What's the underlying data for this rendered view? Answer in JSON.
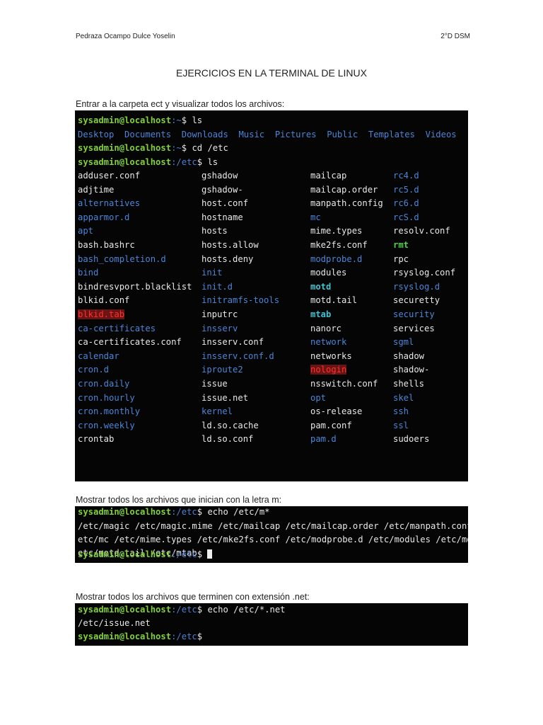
{
  "header": {
    "author": "Pedraza Ocampo Dulce Yoselin",
    "group": "2°D DSM"
  },
  "title": "EJERCICIOS EN LA TERMINAL DE LINUX",
  "sections": [
    {
      "caption": "Entrar a la carpeta ect y visualizar todos los archivos:"
    },
    {
      "caption": "Mostrar todos los archivos que inician con la letra m:"
    },
    {
      "caption": "Mostrar todos los archivos que terminen con extensión .net:"
    }
  ],
  "prompt": {
    "user": "sysadmin@localhost",
    "sep": ":",
    "home": "~",
    "etc": "/etc",
    "dollar": "$"
  },
  "term1": {
    "cmd1": " ls",
    "home_dirs": "Desktop  Documents  Downloads  Music  Pictures  Public  Templates  Videos",
    "cmd2": " cd /etc",
    "cmd3": " ls",
    "columns": [
      [
        [
          "adduser.conf",
          "f"
        ],
        [
          "adjtime",
          "f"
        ],
        [
          "alternatives",
          "d"
        ],
        [
          "apparmor.d",
          "d"
        ],
        [
          "apt",
          "d"
        ],
        [
          "bash.bashrc",
          "f"
        ],
        [
          "bash_completion.d",
          "d"
        ],
        [
          "bind",
          "d"
        ],
        [
          "bindresvport.blacklist",
          "f"
        ],
        [
          "blkid.conf",
          "f"
        ],
        [
          "blkid.tab",
          "r"
        ],
        [
          "ca-certificates",
          "d"
        ],
        [
          "ca-certificates.conf",
          "f"
        ],
        [
          "calendar",
          "d"
        ],
        [
          "cron.d",
          "d"
        ],
        [
          "cron.daily",
          "d"
        ],
        [
          "cron.hourly",
          "d"
        ],
        [
          "cron.monthly",
          "d"
        ],
        [
          "cron.weekly",
          "d"
        ],
        [
          "crontab",
          "f"
        ]
      ],
      [
        [
          "gshadow",
          "f"
        ],
        [
          "gshadow-",
          "f"
        ],
        [
          "host.conf",
          "f"
        ],
        [
          "hostname",
          "f"
        ],
        [
          "hosts",
          "f"
        ],
        [
          "hosts.allow",
          "f"
        ],
        [
          "hosts.deny",
          "f"
        ],
        [
          "init",
          "d"
        ],
        [
          "init.d",
          "d"
        ],
        [
          "initramfs-tools",
          "d"
        ],
        [
          "inputrc",
          "f"
        ],
        [
          "insserv",
          "d"
        ],
        [
          "insserv.conf",
          "f"
        ],
        [
          "insserv.conf.d",
          "d"
        ],
        [
          "iproute2",
          "d"
        ],
        [
          "issue",
          "f"
        ],
        [
          "issue.net",
          "f"
        ],
        [
          "kernel",
          "d"
        ],
        [
          "ld.so.cache",
          "f"
        ],
        [
          "ld.so.conf",
          "f"
        ]
      ],
      [
        [
          "mailcap",
          "f"
        ],
        [
          "mailcap.order",
          "f"
        ],
        [
          "manpath.config",
          "f"
        ],
        [
          "mc",
          "d"
        ],
        [
          "mime.types",
          "f"
        ],
        [
          "mke2fs.conf",
          "f"
        ],
        [
          "modprobe.d",
          "d"
        ],
        [
          "modules",
          "f"
        ],
        [
          "motd",
          "l"
        ],
        [
          "motd.tail",
          "f"
        ],
        [
          "mtab",
          "l"
        ],
        [
          "nanorc",
          "f"
        ],
        [
          "network",
          "d"
        ],
        [
          "networks",
          "f"
        ],
        [
          "nologin",
          "r"
        ],
        [
          "nsswitch.conf",
          "f"
        ],
        [
          "opt",
          "d"
        ],
        [
          "os-release",
          "f"
        ],
        [
          "pam.conf",
          "f"
        ],
        [
          "pam.d",
          "d"
        ]
      ],
      [
        [
          "rc4.d",
          "d"
        ],
        [
          "rc5.d",
          "d"
        ],
        [
          "rc6.d",
          "d"
        ],
        [
          "rcS.d",
          "d"
        ],
        [
          "resolv.conf",
          "f"
        ],
        [
          "rmt",
          "x"
        ],
        [
          "rpc",
          "f"
        ],
        [
          "rsyslog.conf",
          "f"
        ],
        [
          "rsyslog.d",
          "d"
        ],
        [
          "securetty",
          "f"
        ],
        [
          "security",
          "d"
        ],
        [
          "services",
          "f"
        ],
        [
          "sgml",
          "d"
        ],
        [
          "shadow",
          "f"
        ],
        [
          "shadow-",
          "f"
        ],
        [
          "shells",
          "f"
        ],
        [
          "skel",
          "d"
        ],
        [
          "ssh",
          "d"
        ],
        [
          "ssl",
          "d"
        ],
        [
          "sudoers",
          "f"
        ]
      ]
    ]
  },
  "term2": {
    "cmd": " echo /etc/m*",
    "out": [
      "/etc/magic /etc/magic.mime /etc/mailcap /etc/mailcap.order /etc/manpath.config /",
      "etc/mc /etc/mime.types /etc/mke2fs.conf /etc/modprobe.d /etc/modules /etc/motd /",
      "etc/motd.tail /etc/mtab"
    ]
  },
  "term3": {
    "cmd": " echo /etc/*.net",
    "out": "/etc/issue.net"
  }
}
